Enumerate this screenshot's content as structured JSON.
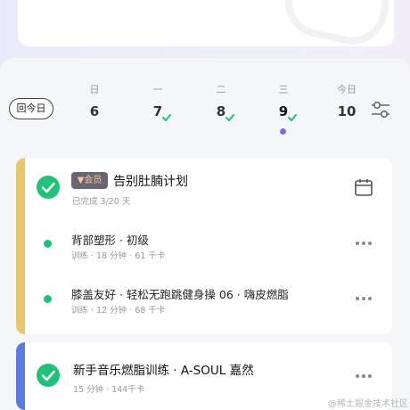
{
  "header": {
    "today_button": "回今日"
  },
  "week": [
    {
      "weekday": "日",
      "date": "6",
      "done": false,
      "selected": false
    },
    {
      "weekday": "一",
      "date": "7",
      "done": true,
      "selected": false
    },
    {
      "weekday": "二",
      "date": "8",
      "done": true,
      "selected": false
    },
    {
      "weekday": "三",
      "date": "9",
      "done": true,
      "selected": true
    },
    {
      "weekday": "今日",
      "date": "10",
      "done": false,
      "selected": false
    }
  ],
  "plan": {
    "badge": "会员",
    "title": "告别肚腩计划",
    "progress": "已完成 3/20 天",
    "items": [
      {
        "title": "背部塑形 · 初级",
        "meta": "训练 · 18 分钟 · 61 千卡"
      },
      {
        "title": "膝盖友好 · 轻松无跑跳健身操 06 · 嗨皮燃脂",
        "meta": "训练 · 12 分钟 · 68 千卡"
      }
    ]
  },
  "single": {
    "title": "新手音乐燃脂训练 · A-SOUL 嘉然",
    "meta": "15 分钟 · 144千卡"
  },
  "watermark": "@稀土掘金技术社区",
  "colors": {
    "plan_bar": "#e8c66e",
    "single_bar": "#5b7ce0",
    "check": "#23c07a",
    "selected_dot": "#7f6fd6"
  }
}
